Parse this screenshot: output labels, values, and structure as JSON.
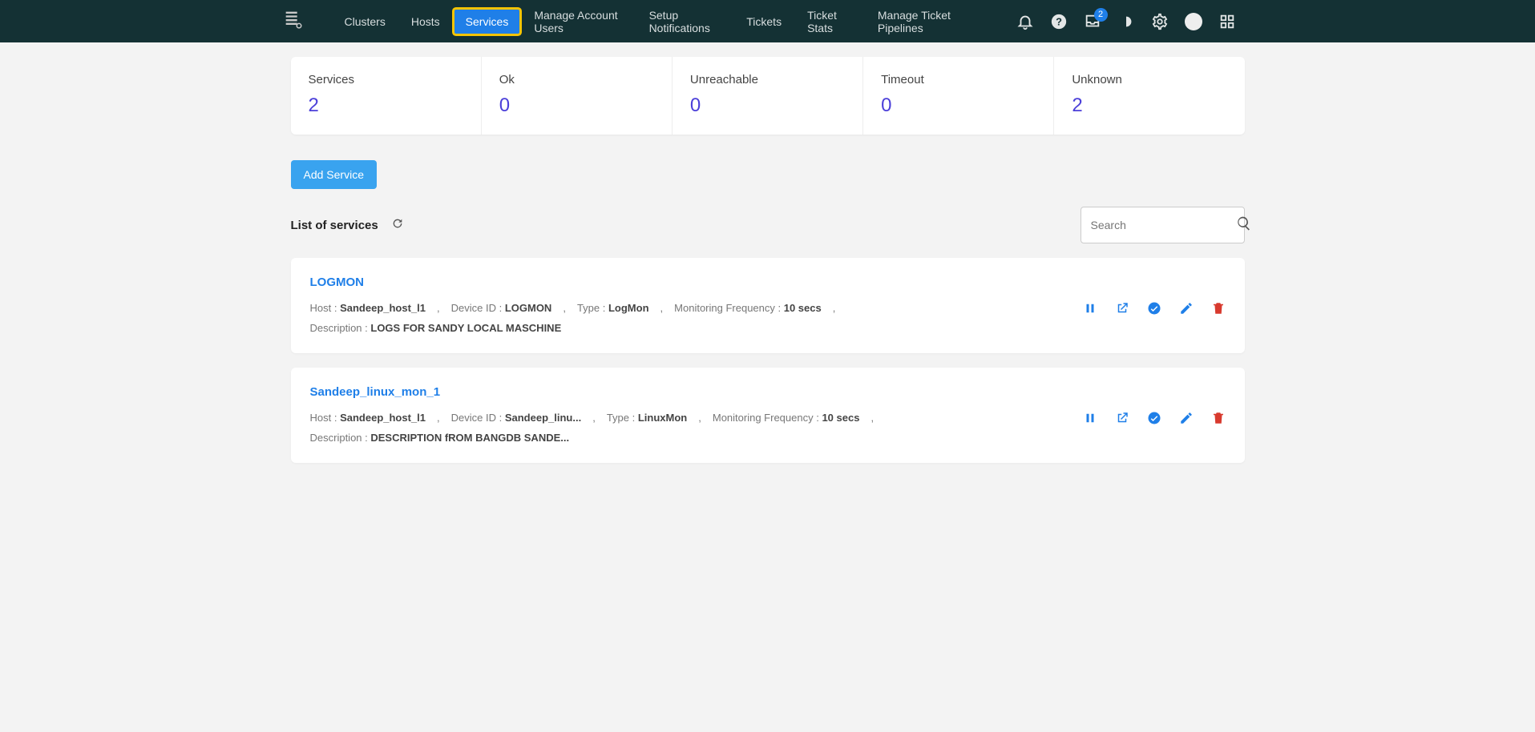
{
  "nav": {
    "items": [
      "Clusters",
      "Hosts",
      "Services",
      "Manage Account Users",
      "Setup Notifications",
      "Tickets",
      "Ticket Stats",
      "Manage Ticket Pipelines"
    ],
    "activeIndex": 2,
    "highlightIndex": 2,
    "badgeCount": "2"
  },
  "stats": [
    {
      "label": "Services",
      "value": "2"
    },
    {
      "label": "Ok",
      "value": "0"
    },
    {
      "label": "Unreachable",
      "value": "0"
    },
    {
      "label": "Timeout",
      "value": "0"
    },
    {
      "label": "Unknown",
      "value": "2"
    }
  ],
  "addServiceLabel": "Add Service",
  "listTitle": "List of services",
  "searchPlaceholder": "Search",
  "metaLabels": {
    "host": "Host : ",
    "deviceId": "Device ID : ",
    "type": "Type : ",
    "freq": "Monitoring Frequency : ",
    "desc": "Description : "
  },
  "services": [
    {
      "name": "LOGMON",
      "host": "Sandeep_host_l1",
      "deviceId": "LOGMON",
      "type": "LogMon",
      "freq": "10 secs",
      "desc": "LOGS FOR SANDY LOCAL MASCHINE"
    },
    {
      "name": "Sandeep_linux_mon_1",
      "host": "Sandeep_host_l1",
      "deviceId": "Sandeep_linu...",
      "type": "LinuxMon",
      "freq": "10 secs",
      "desc": "DESCRIPTION fROM BANGDB SANDE..."
    }
  ]
}
